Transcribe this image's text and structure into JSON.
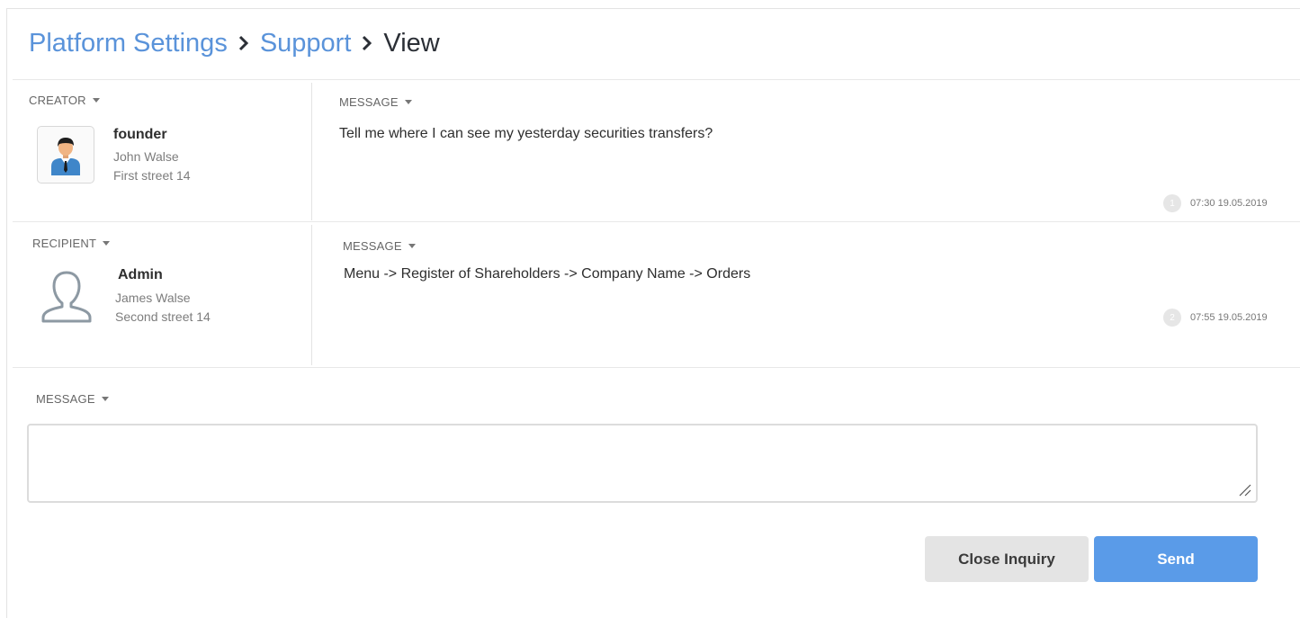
{
  "breadcrumb": {
    "items": [
      "Platform Settings",
      "Support",
      "View"
    ]
  },
  "creator": {
    "label": "CREATOR",
    "username": "founder",
    "full_name": "John Walse",
    "address": "First street 14",
    "avatar_icon": "businessman-avatar-icon"
  },
  "recipient": {
    "label": "RECIPIENT",
    "username": "Admin",
    "full_name": "James Walse",
    "address": "Second street 14",
    "avatar_icon": "user-outline-icon"
  },
  "messages": [
    {
      "label": "MESSAGE",
      "text": "Tell me where I can see my yesterday securities transfers?",
      "index": "1",
      "timestamp": "07:30 19.05.2019"
    },
    {
      "label": "MESSAGE",
      "text": "Menu -> Register of Shareholders -> Company Name -> Orders",
      "index": "2",
      "timestamp": "07:55 19.05.2019"
    }
  ],
  "reply": {
    "label": "MESSAGE",
    "value": "",
    "placeholder": ""
  },
  "actions": {
    "close_label": "Close Inquiry",
    "send_label": "Send"
  },
  "colors": {
    "link": "#5a93da",
    "send_button": "#5a9be8",
    "close_button": "#e4e4e4"
  }
}
